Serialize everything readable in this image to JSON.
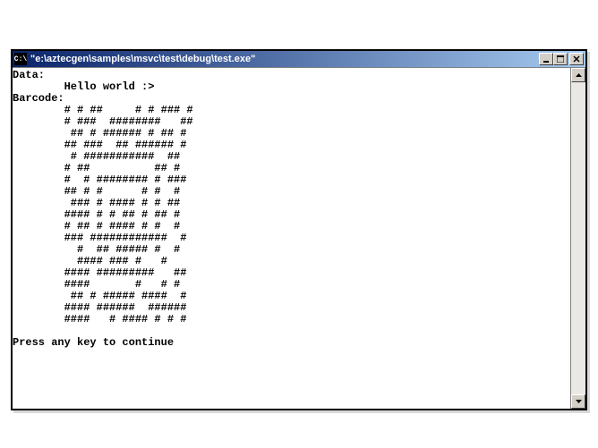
{
  "window": {
    "icon_label": "C:\\",
    "title": "\"e:\\aztecgen\\samples\\msvc\\test\\debug\\test.exe\""
  },
  "console": {
    "data_label": "Data:",
    "data_value": "        Hello world :>",
    "barcode_label": "Barcode:",
    "barcode_lines": [
      "        # # ##     # # ### #",
      "        # ###  ########   ##",
      "         ## # ###### # ## #",
      "        ## ###  ## ###### #",
      "         # ###########  ##",
      "        # ##          ## #",
      "        #  # ######## # ###",
      "        ## # #      # #  #",
      "         ### # #### # # ##",
      "        #### # # ## # ## #",
      "        # ## # #### # #  #",
      "        ### ############  #",
      "          #  ## ##### #  #",
      "          #### ### #   #",
      "        #### #########   ##",
      "        ####       #   # #",
      "         ## # ##### ####  #",
      "        #### ######  ######",
      "        ####   # #### # # #"
    ],
    "continue_prompt": "Press any key to continue"
  }
}
